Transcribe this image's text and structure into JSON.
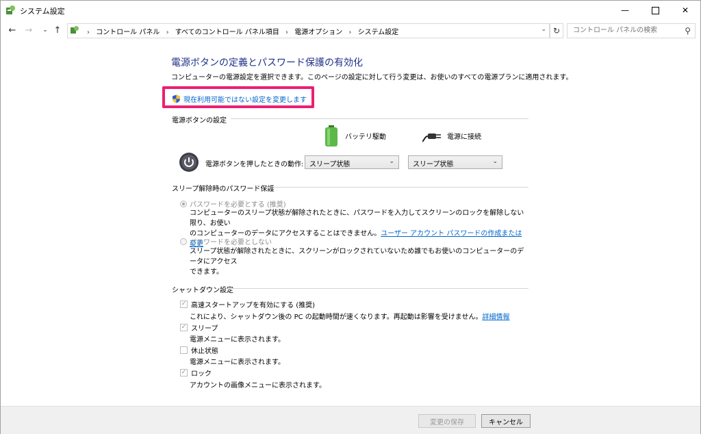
{
  "window": {
    "title": "システム設定"
  },
  "nav": {
    "breadcrumbs": [
      "コントロール パネル",
      "すべてのコントロール パネル項目",
      "電源オプション",
      "システム設定"
    ],
    "search_placeholder": "コントロール パネルの検索"
  },
  "page": {
    "title": "電源ボタンの定義とパスワード保護の有効化",
    "description": "コンピューターの電源設定を選択できます。このページの設定に対して行う変更は、お使いのすべての電源プランに適用されます。",
    "change_link": "現在利用可能ではない設定を変更します"
  },
  "power_button": {
    "section_title": "電源ボタンの設定",
    "battery_label": "バッテリ駆動",
    "plugged_label": "電源に接続",
    "action_label": "電源ボタンを押したときの動作:",
    "battery_value": "スリープ状態",
    "plugged_value": "スリープ状態"
  },
  "password": {
    "section_title": "スリープ解除時のパスワード保護",
    "require_label": "パスワードを必要とする (推奨)",
    "require_desc_1": "コンピューターのスリープ状態が解除されたときに、パスワードを入力してスクリーンのロックを解除しない限り、お使い",
    "require_desc_2": "のコンピューターのデータにアクセスすることはできません。",
    "require_link": "ユーザー アカウント パスワードの作成または変更",
    "norequire_label": "パスワードを必要としない",
    "norequire_desc_1": "スリープ状態が解除されたときに、スクリーンがロックされていないため誰でもお使いのコンピューターのデータにアクセス",
    "norequire_desc_2": "できます。"
  },
  "shutdown": {
    "section_title": "シャットダウン設定",
    "fast_startup_label": "高速スタートアップを有効にする (推奨)",
    "fast_startup_desc": "これにより、シャットダウン後の PC の起動時間が速くなります。再起動は影響を受けません。",
    "fast_startup_link": "詳細情報",
    "sleep_label": "スリープ",
    "sleep_desc": "電源メニューに表示されます。",
    "hibernate_label": "休止状態",
    "hibernate_desc": "電源メニューに表示されます。",
    "lock_label": "ロック",
    "lock_desc": "アカウントの画像メニューに表示されます。"
  },
  "footer": {
    "save_label": "変更の保存",
    "cancel_label": "キャンセル"
  }
}
